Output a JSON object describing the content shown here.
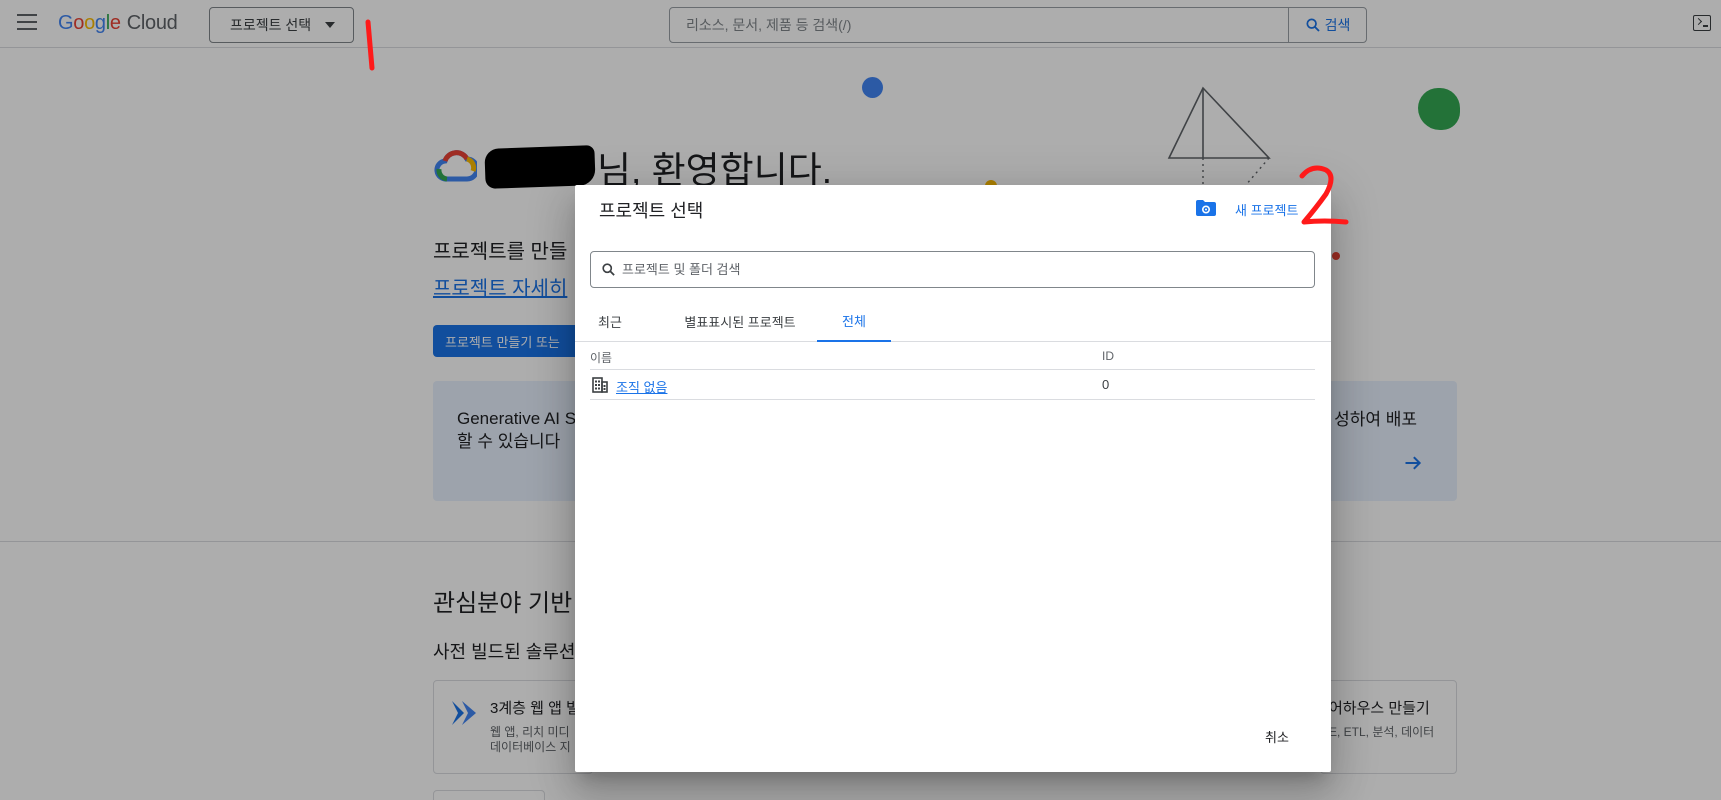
{
  "topbar": {
    "logo_parts": [
      "G",
      "o",
      "o",
      "g",
      "l",
      "e"
    ],
    "logo_product": "Cloud",
    "project_picker_label": "프로젝트 선택",
    "search_placeholder": "리소스, 문서, 제품 등 검색(/)",
    "search_button_label": "검색"
  },
  "page": {
    "welcome_text": "님, 환영합니다.",
    "create_hint": "프로젝트를 만들",
    "project_link": "프로젝트 자세히",
    "create_button": "프로젝트 만들기 또는",
    "genai_left_line1": "Generative AI S",
    "genai_left_line2": "할 수 있습니다",
    "genai_right": "성하여 배포",
    "interest_title": "관심분야 기반",
    "prebuilt_text": "사전 빌드된 솔루션",
    "solution1_title": "3계층 웹 앱 빌",
    "solution1_desc_line1": "웹 앱, 리치 미디",
    "solution1_desc_line2": "데이터베이스 지",
    "solution2_title": "어하우스 만들기",
    "solution2_desc": "E, ETL, 분석, 데이터"
  },
  "dialog": {
    "title": "프로젝트 선택",
    "new_project_label": "새 프로젝트",
    "search_placeholder": "프로젝트 및 폴더 검색",
    "tabs": [
      {
        "label": "최근",
        "active": false
      },
      {
        "label": "별표표시된 프로젝트",
        "active": false
      },
      {
        "label": "전체",
        "active": true
      }
    ],
    "columns": {
      "name": "이름",
      "id": "ID"
    },
    "rows": [
      {
        "name": "조직 없음",
        "id": "0"
      }
    ],
    "cancel_label": "취소"
  },
  "annotations": {
    "mark1": "1",
    "mark2": "2"
  },
  "colors": {
    "accent": "#1a73e8",
    "annotation": "#ff1a1a",
    "overlay": "rgba(0,0,0,0.32)"
  }
}
